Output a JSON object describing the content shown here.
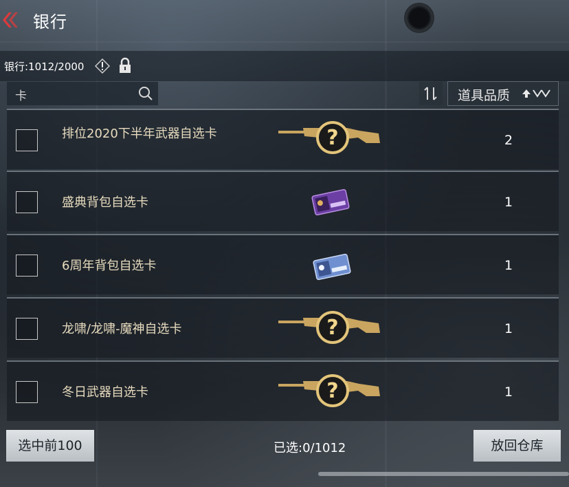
{
  "header": {
    "title": "银行"
  },
  "bank": {
    "count_text": "银行:1012/2000"
  },
  "search": {
    "value": "卡"
  },
  "sort": {
    "quality_label": "道具品质"
  },
  "items": [
    {
      "name": "排位2020下半年武器自选卡",
      "qty": "2",
      "icon": "golden-rifle-question-icon"
    },
    {
      "name": "盛典背包自选卡",
      "qty": "1",
      "icon": "purple-card-icon"
    },
    {
      "name": "6周年背包自选卡",
      "qty": "1",
      "icon": "blue-card-icon"
    },
    {
      "name": "龙啸/龙啸-魔神自选卡",
      "qty": "1",
      "icon": "golden-rifle-question-icon"
    },
    {
      "name": "冬日武器自选卡",
      "qty": "1",
      "icon": "golden-rifle-question-icon"
    }
  ],
  "footer": {
    "select_top_label": "选中前100",
    "selected_text": "已选:0/1012",
    "return_label": "放回仓库"
  },
  "colors": {
    "accent_red": "#e0393b",
    "gold": "#c9a560",
    "item_text": "#e8dcbf"
  }
}
